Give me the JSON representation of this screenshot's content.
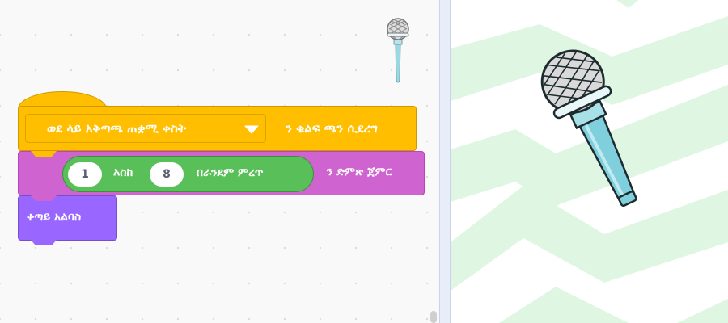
{
  "code_area": {
    "hat_block": {
      "dropdown_value": "ወደ ላይ አቅጣጫ ጠቋሚ ቀስት",
      "label": "ን ቁልፍ ጫን ሲደረግ"
    },
    "sound_block": {
      "random": {
        "from": "1",
        "to_label": "እስከ",
        "to": "8",
        "pick_label": "በራንደም ምረጥ"
      },
      "label": "ን ድምጽ ጀምር"
    },
    "looks_block": {
      "label": "ቀጣይ አልባስ"
    },
    "sprite_icon": "microphone-icon",
    "colors": {
      "events": "#ffbf00",
      "sound": "#cf63cf",
      "operators": "#59c059",
      "looks": "#9966ff"
    }
  },
  "stage": {
    "sprite": "microphone-icon",
    "backdrop": "green-chevron-pattern",
    "colors": {
      "backdrop_stripe": "#dff6e3",
      "mic_body": "#7fd0dc"
    }
  }
}
